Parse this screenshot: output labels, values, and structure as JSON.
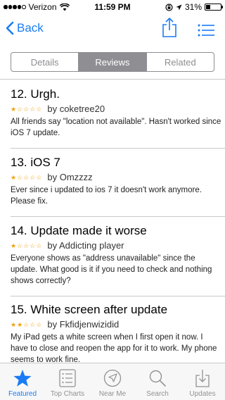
{
  "status_bar": {
    "carrier": "Verizon",
    "time": "11:59 PM",
    "battery": "31%",
    "battery_level": 0.31,
    "signal_bars": 4,
    "signal_total": 5
  },
  "nav": {
    "back_label": "Back",
    "accent_color": "#1a7cf5"
  },
  "segments": [
    {
      "label": "Details",
      "active": false
    },
    {
      "label": "Reviews",
      "active": true
    },
    {
      "label": "Related",
      "active": false
    }
  ],
  "reviews": [
    {
      "title": "12. Urgh.",
      "rating": 1,
      "author": "by coketree20",
      "body": "All friends say \"location not available\". Hasn't worked since iOS 7 update."
    },
    {
      "title": "13. iOS 7",
      "rating": 1,
      "author": "by Omzzzz",
      "body": "Ever since i updated to ios 7 it doesn't work anymore. Please fix."
    },
    {
      "title": "14. Update made it worse",
      "rating": 1,
      "author": "by Addicting player",
      "body": "Everyone shows as \"address unavailable\" since the update. What good is it if you need to check and nothing shows correctly?"
    },
    {
      "title": "15. White screen after update",
      "rating": 2,
      "author": "by Fkfidjenwizidid",
      "body": "My iPad gets a white screen when I first open it now. I have to close and reopen the app for it to work. My phone seems to work fine."
    }
  ],
  "tabs": [
    {
      "label": "Featured",
      "icon": "star-icon",
      "active": true
    },
    {
      "label": "Top Charts",
      "icon": "list-icon",
      "active": false
    },
    {
      "label": "Near Me",
      "icon": "compass-icon",
      "active": false
    },
    {
      "label": "Search",
      "icon": "search-icon",
      "active": false
    },
    {
      "label": "Updates",
      "icon": "download-icon",
      "active": false
    }
  ]
}
